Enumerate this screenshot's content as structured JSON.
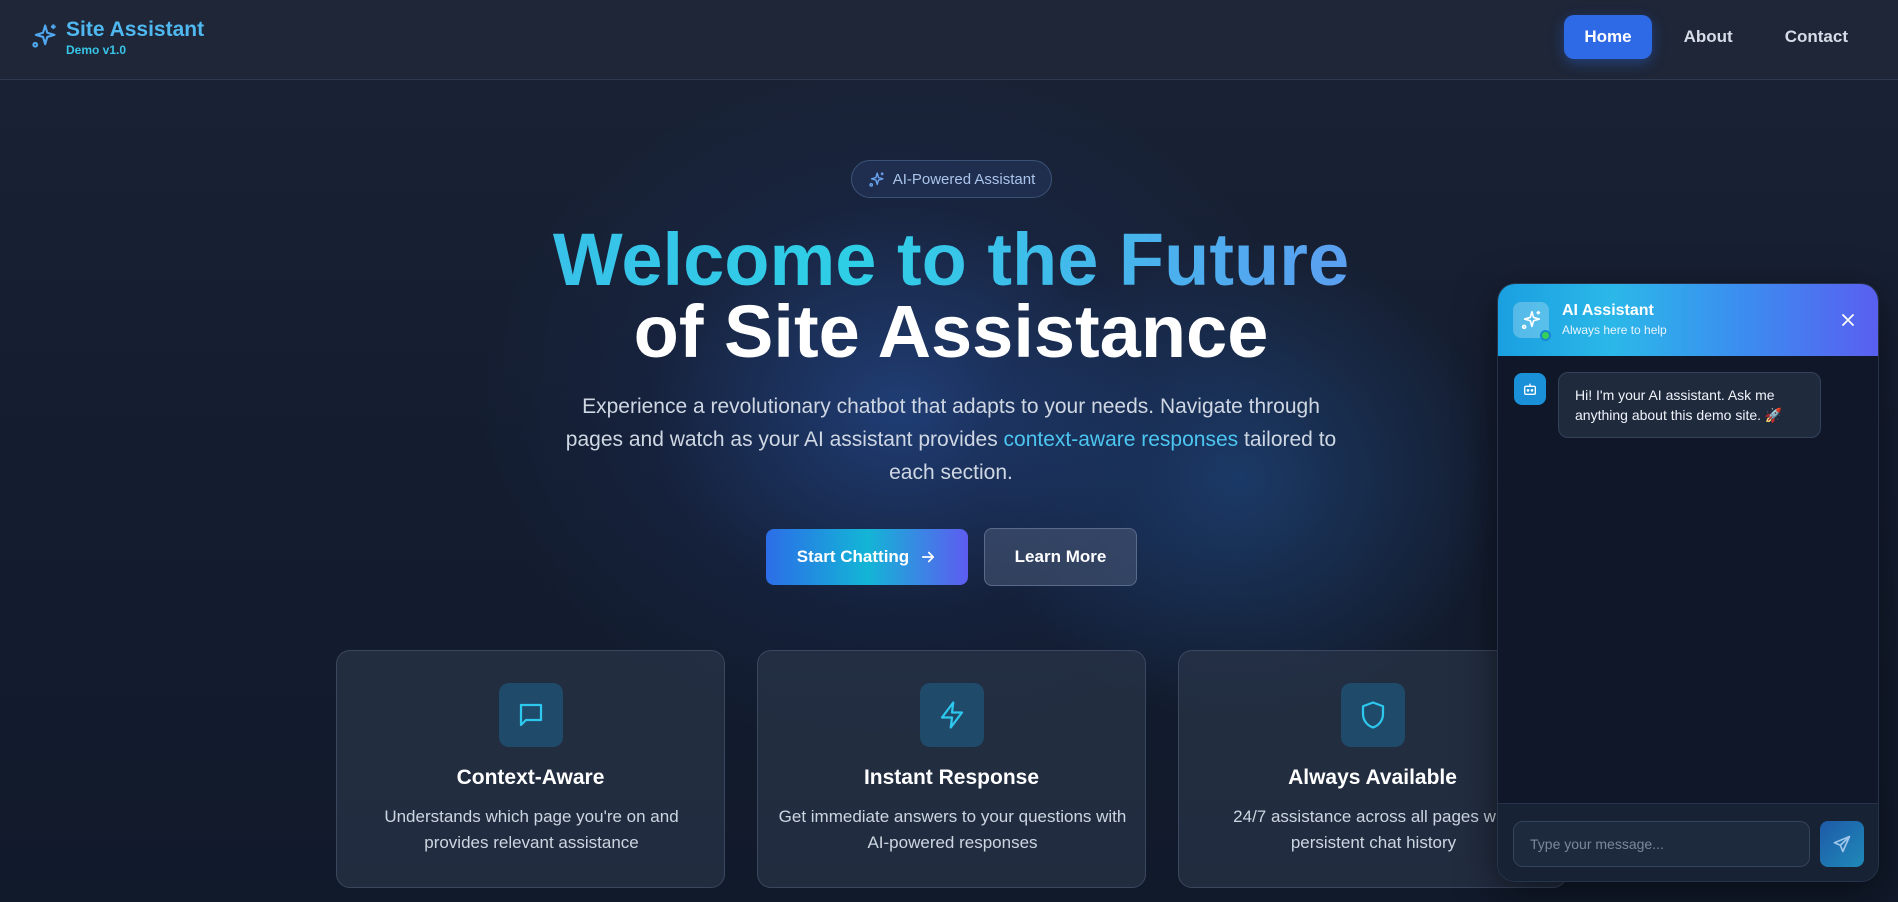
{
  "brand": {
    "title": "Site Assistant",
    "subtitle": "Demo v1.0",
    "icon": "sparkles-icon"
  },
  "nav": {
    "items": [
      {
        "label": "Home",
        "active": true
      },
      {
        "label": "About",
        "active": false
      },
      {
        "label": "Contact",
        "active": false
      }
    ]
  },
  "hero": {
    "badge": "AI-Powered Assistant",
    "headline_line1": "Welcome to the Future",
    "headline_line2": "of Site Assistance",
    "desc_part1": "Experience a revolutionary chatbot that adapts to your needs. Navigate through pages and watch as your AI assistant provides ",
    "desc_highlight": "context-aware responses",
    "desc_part2": " tailored to each section.",
    "primary_button": "Start Chatting",
    "secondary_button": "Learn More"
  },
  "features": [
    {
      "icon": "message-square-icon",
      "title": "Context-Aware",
      "desc": "Understands which page you're on and provides relevant assistance"
    },
    {
      "icon": "lightning-icon",
      "title": "Instant Response",
      "desc": "Get immediate answers to your questions with AI-powered responses"
    },
    {
      "icon": "shield-icon",
      "title": "Always Available",
      "desc": "24/7 assistance across all pages with persistent chat history"
    }
  ],
  "chat": {
    "title": "AI Assistant",
    "subtitle": "Always here to help",
    "messages": [
      {
        "from": "bot",
        "text": "Hi! I'm your AI assistant. Ask me anything about this demo site. 🚀"
      }
    ],
    "input_placeholder": "Type your message..."
  },
  "colors": {
    "accent": "#2f6ae6",
    "highlight": "#4cc6f0",
    "online": "#34d058"
  }
}
